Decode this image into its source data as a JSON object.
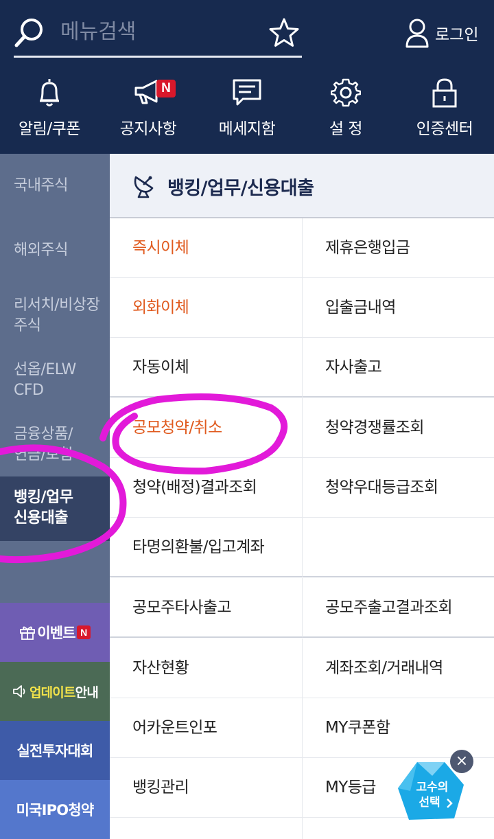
{
  "header": {
    "search_placeholder": "메뉴검색",
    "login_label": "로그인",
    "quick_menu": [
      {
        "icon": "bell-icon",
        "label": "알림/쿠폰",
        "badge": ""
      },
      {
        "icon": "megaphone-icon",
        "label": "공지사항",
        "badge": "N"
      },
      {
        "icon": "message-icon",
        "label": "메세지함",
        "badge": ""
      },
      {
        "icon": "gear-icon",
        "label": "설 정",
        "badge": ""
      },
      {
        "icon": "lock-icon",
        "label": "인증센터",
        "badge": ""
      }
    ]
  },
  "sidebar": {
    "items": [
      {
        "label": "국내주식"
      },
      {
        "label": "해외주식"
      },
      {
        "label": "리서치/비상장 주식"
      },
      {
        "label": "선옵/ELW CFD"
      },
      {
        "label": "금융상품/ 연금/보험"
      },
      {
        "label": "뱅킹/업무 신용대출",
        "active": true
      }
    ],
    "promos": {
      "event": {
        "label": "이벤트",
        "badge": "N",
        "icon": "gift-icon",
        "color": "#6f5db3"
      },
      "update": {
        "label_highlight": "업데이트",
        "label_rest": "안내",
        "icon": "speaker-icon",
        "color": "#4b6a55"
      },
      "contest": {
        "label": "실전투자대회",
        "color": "#3e5ba8"
      },
      "ipo": {
        "label": "미국IPO청약",
        "color": "#5477cc"
      }
    }
  },
  "main": {
    "section_icon": "satellite-dish-icon",
    "section_title": "뱅킹/업무/신용대출",
    "menu_rows": [
      [
        "즉시이체",
        "제휴은행입금"
      ],
      [
        "외화이체",
        "입출금내역"
      ],
      [
        "자동이체",
        "자사출고"
      ],
      [
        "공모청약/취소",
        "청약경쟁률조회"
      ],
      [
        "청약(배정)결과조회",
        "청약우대등급조회"
      ],
      [
        "타명의환불/입고계좌",
        ""
      ],
      [
        "공모주타사출고",
        "공모주출고결과조회"
      ],
      [
        "자산현황",
        "계좌조회/거래내역"
      ],
      [
        "어카운트인포",
        "MY쿠폰함"
      ],
      [
        "뱅킹관리",
        "MY등급"
      ]
    ],
    "highlighted_items": [
      "즉시이체",
      "외화이체",
      "공모청약/취소"
    ]
  },
  "floating_badge": {
    "line1": "고수의",
    "line2": "선택",
    "close_label": "×"
  },
  "colors": {
    "header_bg": "#172a4f",
    "sidebar_bg": "#5d6d8c",
    "sidebar_active_bg": "#344364",
    "accent_orange": "#e05a1e",
    "annotation_magenta": "#e21ad9"
  }
}
